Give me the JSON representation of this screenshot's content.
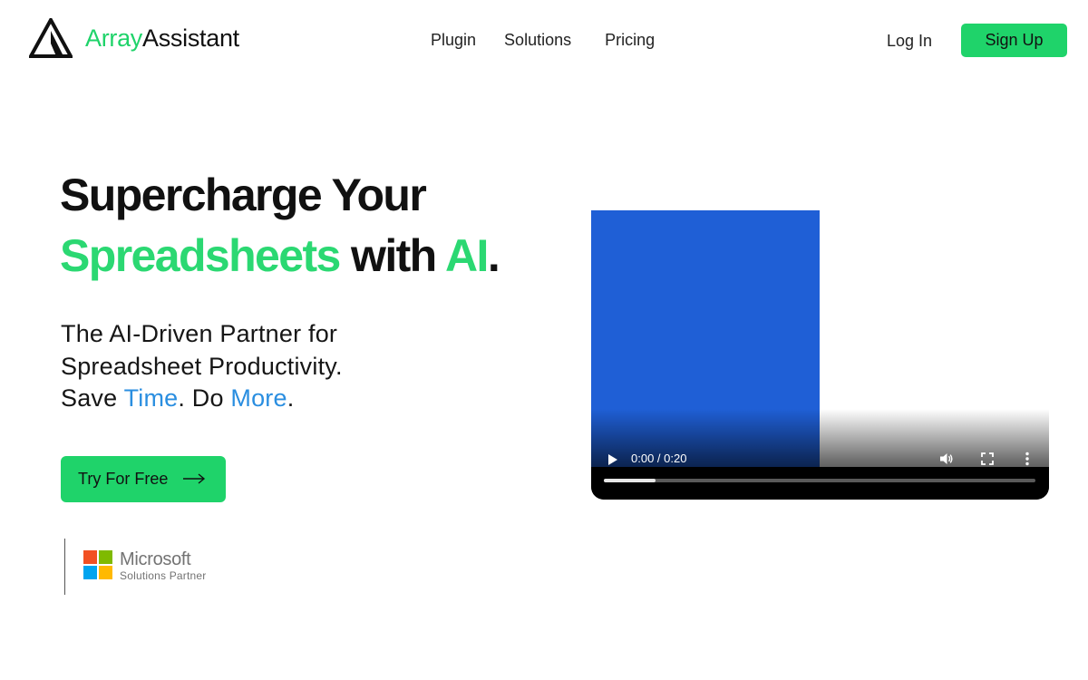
{
  "header": {
    "logo": {
      "icon": "triangle-logo-icon",
      "text_green": "Array",
      "text_dark": "Assistant"
    },
    "nav": [
      {
        "label": "Plugin"
      },
      {
        "label": "Solutions"
      },
      {
        "label": "Pricing"
      }
    ],
    "login_label": "Log In",
    "signup_label": "Sign Up"
  },
  "hero": {
    "line1": "Supercharge Your",
    "line2_green": "Spreadsheets",
    "line2_mid": " with ",
    "line2_green2": "AI",
    "line2_end": ".",
    "sub_line1": "The AI-Driven Partner for",
    "sub_line2": "Spreadsheet Productivity.",
    "sub_line3_a": "Save ",
    "sub_line3_time": "Time",
    "sub_line3_b": ". Do ",
    "sub_line3_more": "More",
    "sub_line3_c": ".",
    "cta_label": "Try For Free"
  },
  "partner": {
    "name": "Microsoft",
    "subtitle": "Solutions Partner"
  },
  "video": {
    "time": "0:00 / 0:20",
    "progress": 0.12
  },
  "colors": {
    "accent_green": "#1fd36a",
    "accent_blue": "#2a8ee0",
    "video_blue": "#1f5fd6"
  }
}
